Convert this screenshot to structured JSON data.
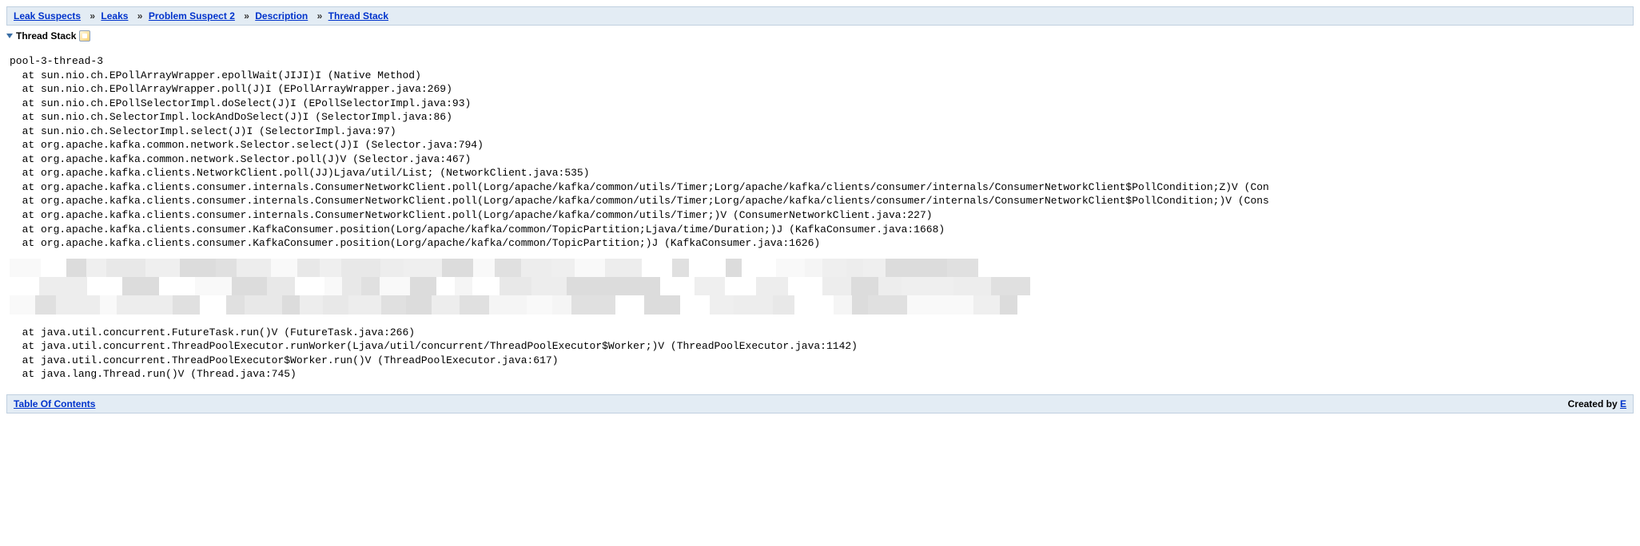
{
  "breadcrumb": {
    "items": [
      {
        "label": "Leak Suspects"
      },
      {
        "label": "Leaks"
      },
      {
        "label": "Problem Suspect 2"
      },
      {
        "label": "Description"
      },
      {
        "label": "Thread Stack"
      }
    ],
    "separator": "»"
  },
  "section": {
    "title": "Thread Stack"
  },
  "stack": {
    "thread_name": "pool-3-thread-3",
    "lines_top": [
      "  at sun.nio.ch.EPollArrayWrapper.epollWait(JIJI)I (Native Method)",
      "  at sun.nio.ch.EPollArrayWrapper.poll(J)I (EPollArrayWrapper.java:269)",
      "  at sun.nio.ch.EPollSelectorImpl.doSelect(J)I (EPollSelectorImpl.java:93)",
      "  at sun.nio.ch.SelectorImpl.lockAndDoSelect(J)I (SelectorImpl.java:86)",
      "  at sun.nio.ch.SelectorImpl.select(J)I (SelectorImpl.java:97)",
      "  at org.apache.kafka.common.network.Selector.select(J)I (Selector.java:794)",
      "  at org.apache.kafka.common.network.Selector.poll(J)V (Selector.java:467)",
      "  at org.apache.kafka.clients.NetworkClient.poll(JJ)Ljava/util/List; (NetworkClient.java:535)",
      "  at org.apache.kafka.clients.consumer.internals.ConsumerNetworkClient.poll(Lorg/apache/kafka/common/utils/Timer;Lorg/apache/kafka/clients/consumer/internals/ConsumerNetworkClient$PollCondition;Z)V (Con",
      "  at org.apache.kafka.clients.consumer.internals.ConsumerNetworkClient.poll(Lorg/apache/kafka/common/utils/Timer;Lorg/apache/kafka/clients/consumer/internals/ConsumerNetworkClient$PollCondition;)V (Cons",
      "  at org.apache.kafka.clients.consumer.internals.ConsumerNetworkClient.poll(Lorg/apache/kafka/common/utils/Timer;)V (ConsumerNetworkClient.java:227)",
      "  at org.apache.kafka.clients.consumer.KafkaConsumer.position(Lorg/apache/kafka/common/TopicPartition;Ljava/time/Duration;)J (KafkaConsumer.java:1668)",
      "  at org.apache.kafka.clients.consumer.KafkaConsumer.position(Lorg/apache/kafka/common/TopicPartition;)J (KafkaConsumer.java:1626)"
    ],
    "lines_bottom": [
      "  at java.util.concurrent.FutureTask.run()V (FutureTask.java:266)",
      "  at java.util.concurrent.ThreadPoolExecutor.runWorker(Ljava/util/concurrent/ThreadPoolExecutor$Worker;)V (ThreadPoolExecutor.java:1142)",
      "  at java.util.concurrent.ThreadPoolExecutor$Worker.run()V (ThreadPoolExecutor.java:617)",
      "  at java.lang.Thread.run()V (Thread.java:745)"
    ]
  },
  "footer": {
    "toc_label": "Table Of Contents",
    "created_by_prefix": "Created by ",
    "created_by_link": "E"
  }
}
